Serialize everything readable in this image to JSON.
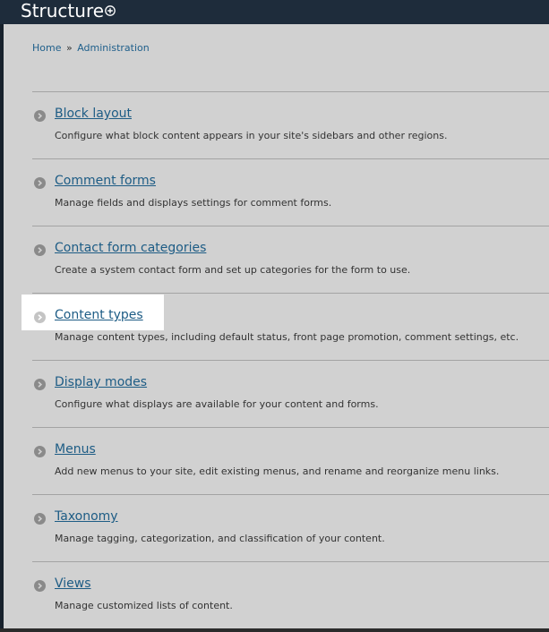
{
  "header": {
    "title": "Structure"
  },
  "breadcrumb": {
    "home": "Home",
    "separator": "»",
    "admin": "Administration"
  },
  "items": [
    {
      "title": "Block layout",
      "description": "Configure what block content appears in your site's sidebars and other regions."
    },
    {
      "title": "Comment forms",
      "description": "Manage fields and displays settings for comment forms."
    },
    {
      "title": "Contact form categories",
      "description": "Create a system contact form and set up categories for the form to use."
    },
    {
      "title": "Content types",
      "description": "Manage content types, including default status, front page promotion, comment settings, etc."
    },
    {
      "title": "Display modes",
      "description": "Configure what displays are available for your content and forms."
    },
    {
      "title": "Menus",
      "description": "Add new menus to your site, edit existing menus, and rename and reorganize menu links."
    },
    {
      "title": "Taxonomy",
      "description": "Manage tagging, categorization, and classification of your content."
    },
    {
      "title": "Views",
      "description": "Manage customized lists of content."
    }
  ],
  "colors": {
    "link": "#1d5c85",
    "panel": "#d1d1d1",
    "topbar": "#1e2c3b"
  },
  "icons": {
    "title_icon": "plus-circle-icon",
    "item_icon": "chevron-right-circle-icon"
  }
}
